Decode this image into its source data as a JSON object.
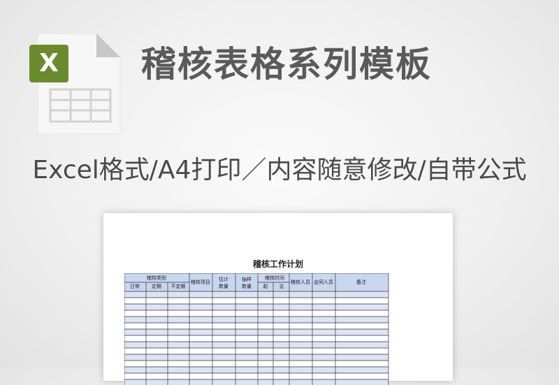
{
  "header": {
    "title": "稽核表格系列模板",
    "subtitle": "Excel格式/A4打印／内容随意修改/自带公式"
  },
  "icon": {
    "name": "excel-file-icon",
    "badge_glyph": "X",
    "badge_color": "#6b8a2e",
    "page_color": "#f6f6f6",
    "fold_color": "#c8c8c8",
    "grid_color": "#d2d2d2"
  },
  "sheet": {
    "title": "稽核工作计划",
    "header_color": "#c9d6f0",
    "band_color": "#dbe3f5",
    "group_headers": {
      "category": "稽核类别",
      "item": "稽核项目",
      "estimate": "估计数量",
      "sample": "抽样数量",
      "time": "稽核时间",
      "auditor": "稽核人员",
      "partner": "会同人员",
      "note": "备注"
    },
    "sub_headers": {
      "daily": "日常",
      "regular": "定期",
      "irregular": "不定期",
      "start": "起",
      "end": "讫"
    }
  }
}
